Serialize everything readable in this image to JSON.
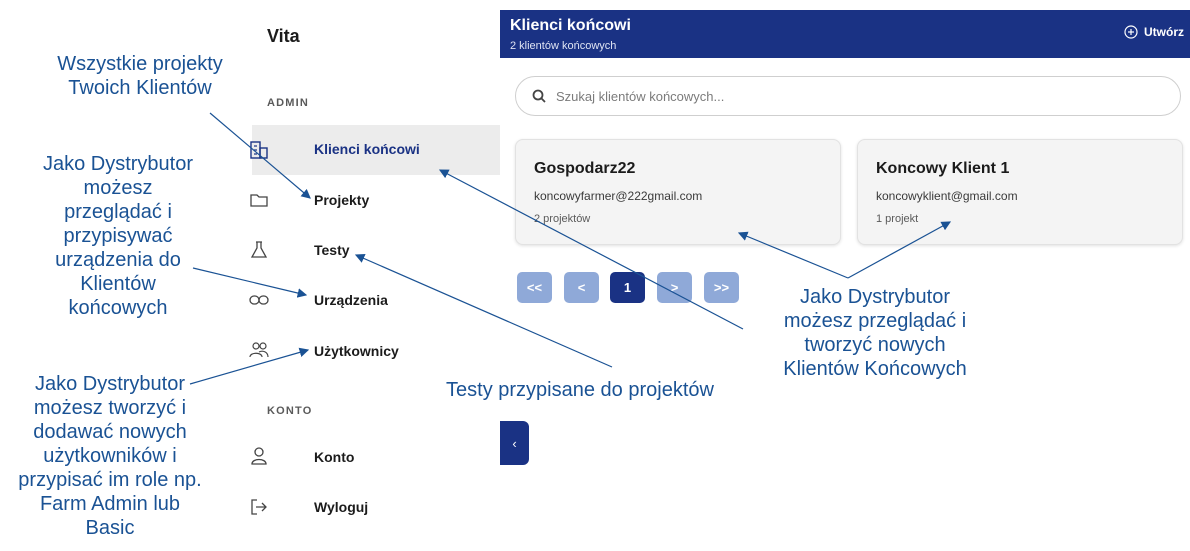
{
  "sidebar": {
    "brand": "Vita",
    "section_admin": "ADMIN",
    "section_account": "KONTO",
    "items": [
      {
        "label": "Klienci końcowi",
        "icon": "building-icon"
      },
      {
        "label": "Projekty",
        "icon": "folder-icon"
      },
      {
        "label": "Testy",
        "icon": "flask-icon"
      },
      {
        "label": "Urządzenia",
        "icon": "link-icon"
      },
      {
        "label": "Użytkownicy",
        "icon": "users-icon"
      }
    ],
    "account_items": [
      {
        "label": "Konto",
        "icon": "user-icon"
      },
      {
        "label": "Wyloguj",
        "icon": "logout-icon"
      }
    ]
  },
  "header": {
    "title": "Klienci końcowi",
    "subtitle": "2 klientów końcowych",
    "create_label": "Utwórz"
  },
  "search": {
    "placeholder": "Szukaj klientów końcowych..."
  },
  "cards": [
    {
      "name": "Gospodarz22",
      "email": "koncowyfarmer@222gmail.com",
      "projects": "2 projektów"
    },
    {
      "name": "Koncowy Klient 1",
      "email": "koncowyklient@gmail.com",
      "projects": "1 projekt"
    }
  ],
  "pagination": {
    "first": "<<",
    "prev": "<",
    "current": "1",
    "next": ">",
    "last": ">>"
  },
  "collapse_label": "‹",
  "annotations": {
    "a1_line1": "Wszystkie projekty",
    "a1_line2": "Twoich Klientów",
    "a2_line1": "Jako Dystrybutor",
    "a2_line2": "możesz",
    "a2_line3": "przeglądać i",
    "a2_line4": "przypisywać",
    "a2_line5": "urządzenia do",
    "a2_line6": "Klientów",
    "a2_line7": "końcowych",
    "a3_line1": "Jako Dystrybutor",
    "a3_line2": "możesz tworzyć i",
    "a3_line3": "dodawać nowych",
    "a3_line4": "użytkowników i",
    "a3_line5": "przypisać im role np.",
    "a3_line6": "Farm Admin lub",
    "a3_line7": "Basic",
    "a4": "Testy przypisane do projektów",
    "a5_line1": "Jako Dystrybutor",
    "a5_line2": "możesz przeglądać i",
    "a5_line3": "tworzyć nowych",
    "a5_line4": "Klientów Końcowych"
  },
  "colors": {
    "primary": "#1a3284",
    "pagination_inactive": "#8fa9d8",
    "annotation": "#1a5294"
  }
}
